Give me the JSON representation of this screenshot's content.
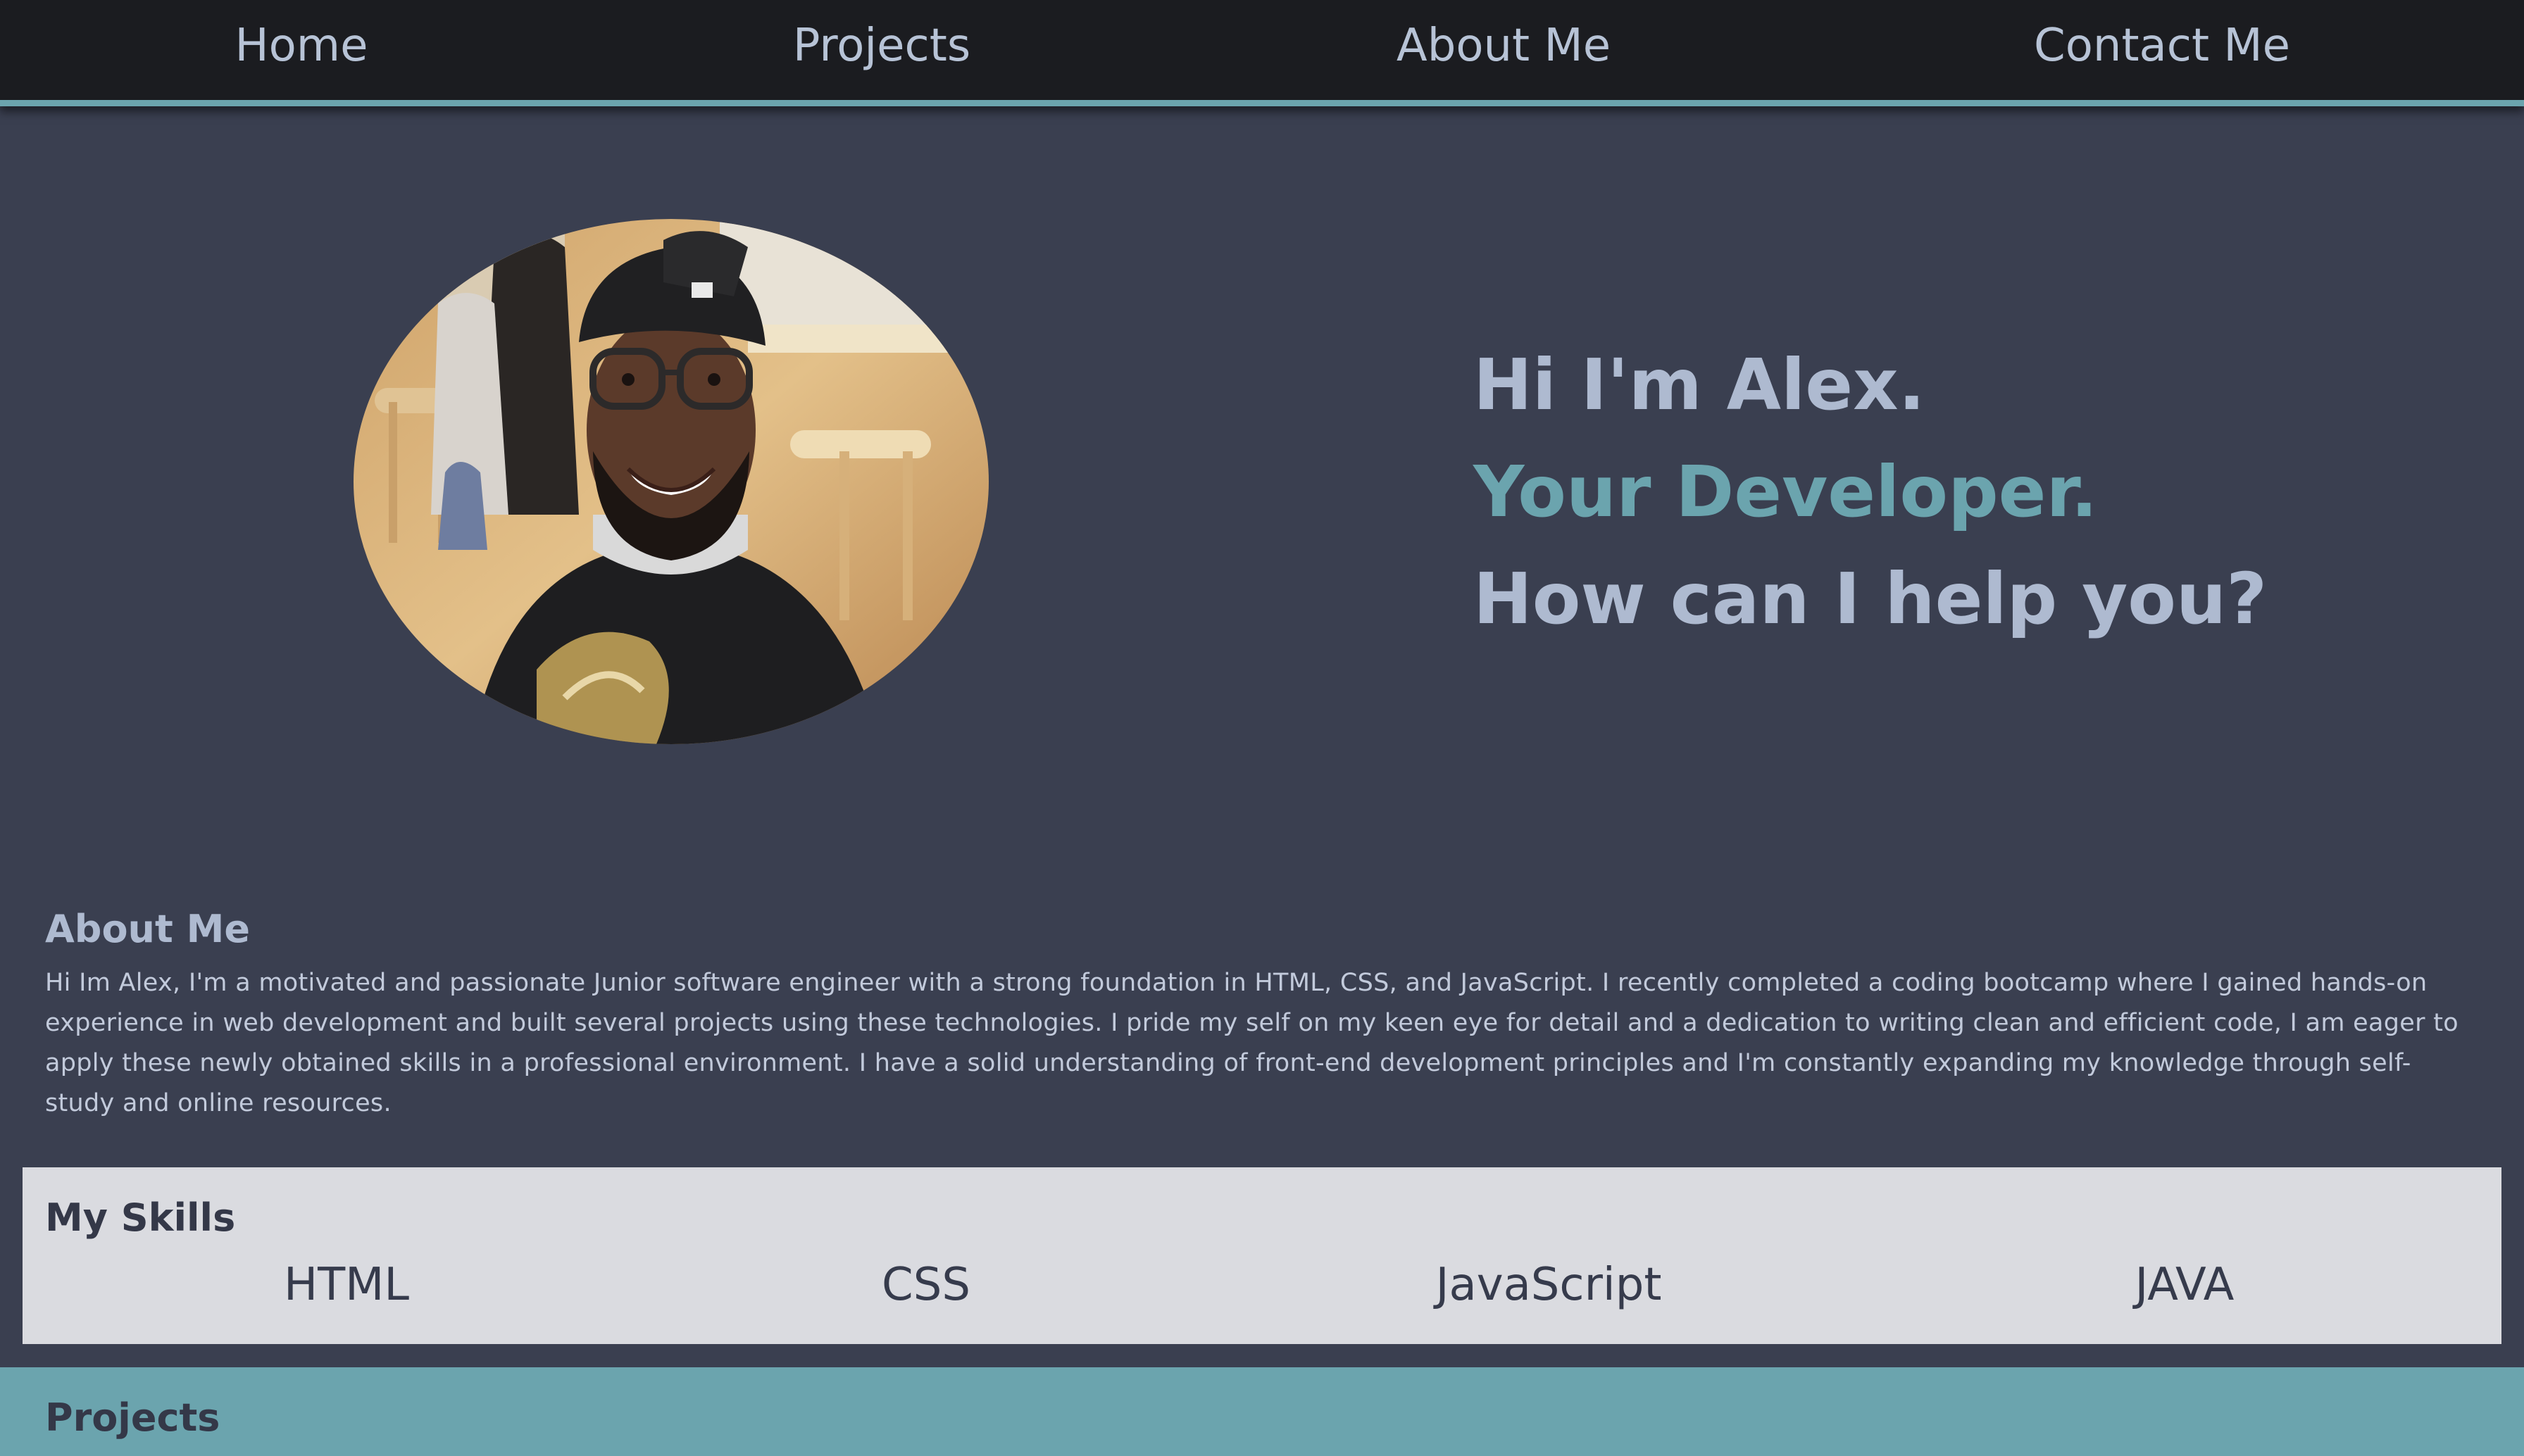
{
  "nav": {
    "items": [
      {
        "label": "Home"
      },
      {
        "label": "Projects"
      },
      {
        "label": "About Me"
      },
      {
        "label": "Contact Me"
      }
    ]
  },
  "hero": {
    "line1": "Hi I'm Alex.",
    "line2": "Your Developer.",
    "line3": "How can I help you?"
  },
  "about": {
    "title": "About Me",
    "body": "Hi Im Alex, I'm a motivated and passionate Junior software engineer with a strong foundation in HTML, CSS, and JavaScript. I recently completed a coding bootcamp where I gained hands-on experience in web development and built several projects using these technologies. I pride my self on my keen eye for detail and a dedication to writing clean and efficient code, I am eager to apply these newly obtained skills in a professional environment. I have a solid understanding of front-end development principles and I'm constantly expanding my knowledge through self-study and online resources."
  },
  "skills": {
    "title": "My Skills",
    "items": [
      "HTML",
      "CSS",
      "JavaScript",
      "JAVA"
    ]
  },
  "projects": {
    "title": "Projects"
  },
  "colors": {
    "page_bg": "#3a3f50",
    "nav_bg": "#1b1c20",
    "accent": "#6ba4ae",
    "hero_text": "#aebad0",
    "skills_bg": "#dadbe0"
  }
}
